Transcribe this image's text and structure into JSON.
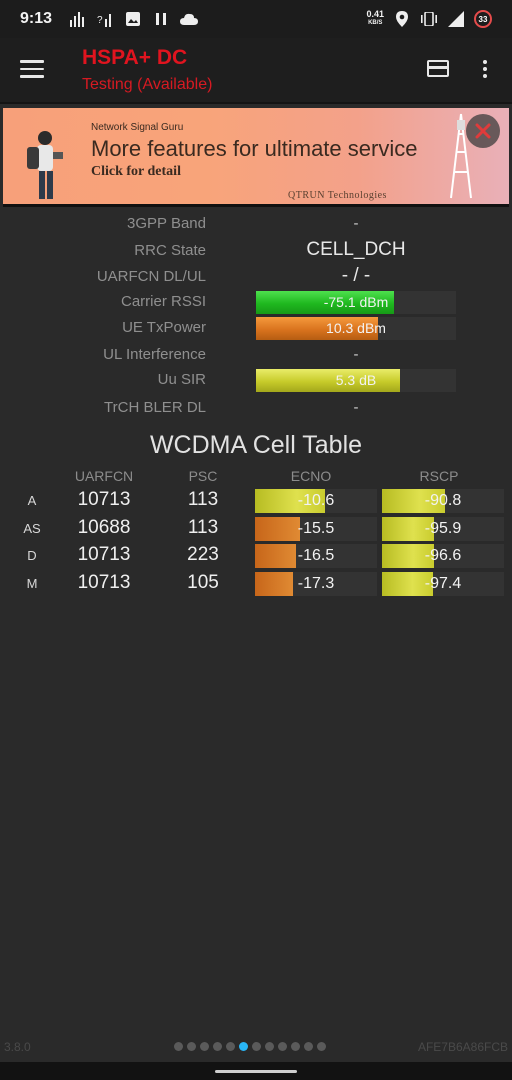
{
  "status_bar": {
    "time": "9:13",
    "net_speed_value": "0.41",
    "net_speed_unit": "KB/S",
    "battery": "33",
    "icons_left": [
      "signal-bars-icon",
      "no-signal-icon",
      "image-icon",
      "pause-icon",
      "cloud-icon"
    ],
    "icons_right": [
      "location-icon",
      "vibrate-icon",
      "signal-5g-icon",
      "battery-icon"
    ]
  },
  "appbar": {
    "title": "HSPA+ DC",
    "subtitle": "Testing (Available)",
    "title_color": "#e0141f"
  },
  "ad": {
    "brand": "Network Signal Guru",
    "headline": "More features for ultimate service",
    "cta": "Click for detail",
    "company": "QTRUN Technologies"
  },
  "info": {
    "band_label": "3GPP Band",
    "band_value": "-",
    "rrc_label": "RRC State",
    "rrc_value": "CELL_DCH",
    "uarfcn_label": "UARFCN DL/UL",
    "uarfcn_value": "- / -",
    "rssi_label": "Carrier RSSI",
    "rssi_value": "-75.1 dBm",
    "rssi_fill_fraction": 0.69,
    "txpower_label": "UE TxPower",
    "txpower_value": "10.3 dBm",
    "txpower_fill_fraction": 0.61,
    "ul_interference_label": "UL Interference",
    "ul_interference_value": "-",
    "sir_label": "Uu SIR",
    "sir_value": "5.3 dB",
    "sir_fill_fraction": 0.72,
    "bler_label": "TrCH BLER DL",
    "bler_value": "-"
  },
  "cell_table": {
    "title": "WCDMA Cell Table",
    "headers": {
      "uarfcn": "UARFCN",
      "psc": "PSC",
      "ecno": "ECNO",
      "rscp": "RSCP"
    },
    "rows": [
      {
        "type": "A",
        "uarfcn": "10713",
        "psc": "113",
        "ecno": "-10.6",
        "ecno_fill": 0.57,
        "ecno_color": "yellow",
        "rscp": "-90.8",
        "rscp_fill": 0.52,
        "rscp_color": "yellow"
      },
      {
        "type": "AS",
        "uarfcn": "10688",
        "psc": "113",
        "ecno": "-15.5",
        "ecno_fill": 0.37,
        "ecno_color": "orange",
        "rscp": "-95.9",
        "rscp_fill": 0.43,
        "rscp_color": "yellow"
      },
      {
        "type": "D",
        "uarfcn": "10713",
        "psc": "223",
        "ecno": "-16.5",
        "ecno_fill": 0.34,
        "ecno_color": "orange",
        "rscp": "-96.6",
        "rscp_fill": 0.43,
        "rscp_color": "yellow"
      },
      {
        "type": "M",
        "uarfcn": "10713",
        "psc": "105",
        "ecno": "-17.3",
        "ecno_fill": 0.31,
        "ecno_color": "orange",
        "rscp": "-97.4",
        "rscp_fill": 0.42,
        "rscp_color": "yellow"
      }
    ]
  },
  "footer": {
    "version": "3.8.0",
    "device_id": "AFE7B6A86FCB",
    "page_count": 12,
    "active_page": 5,
    "active_dot_color": "#29b6f6"
  }
}
